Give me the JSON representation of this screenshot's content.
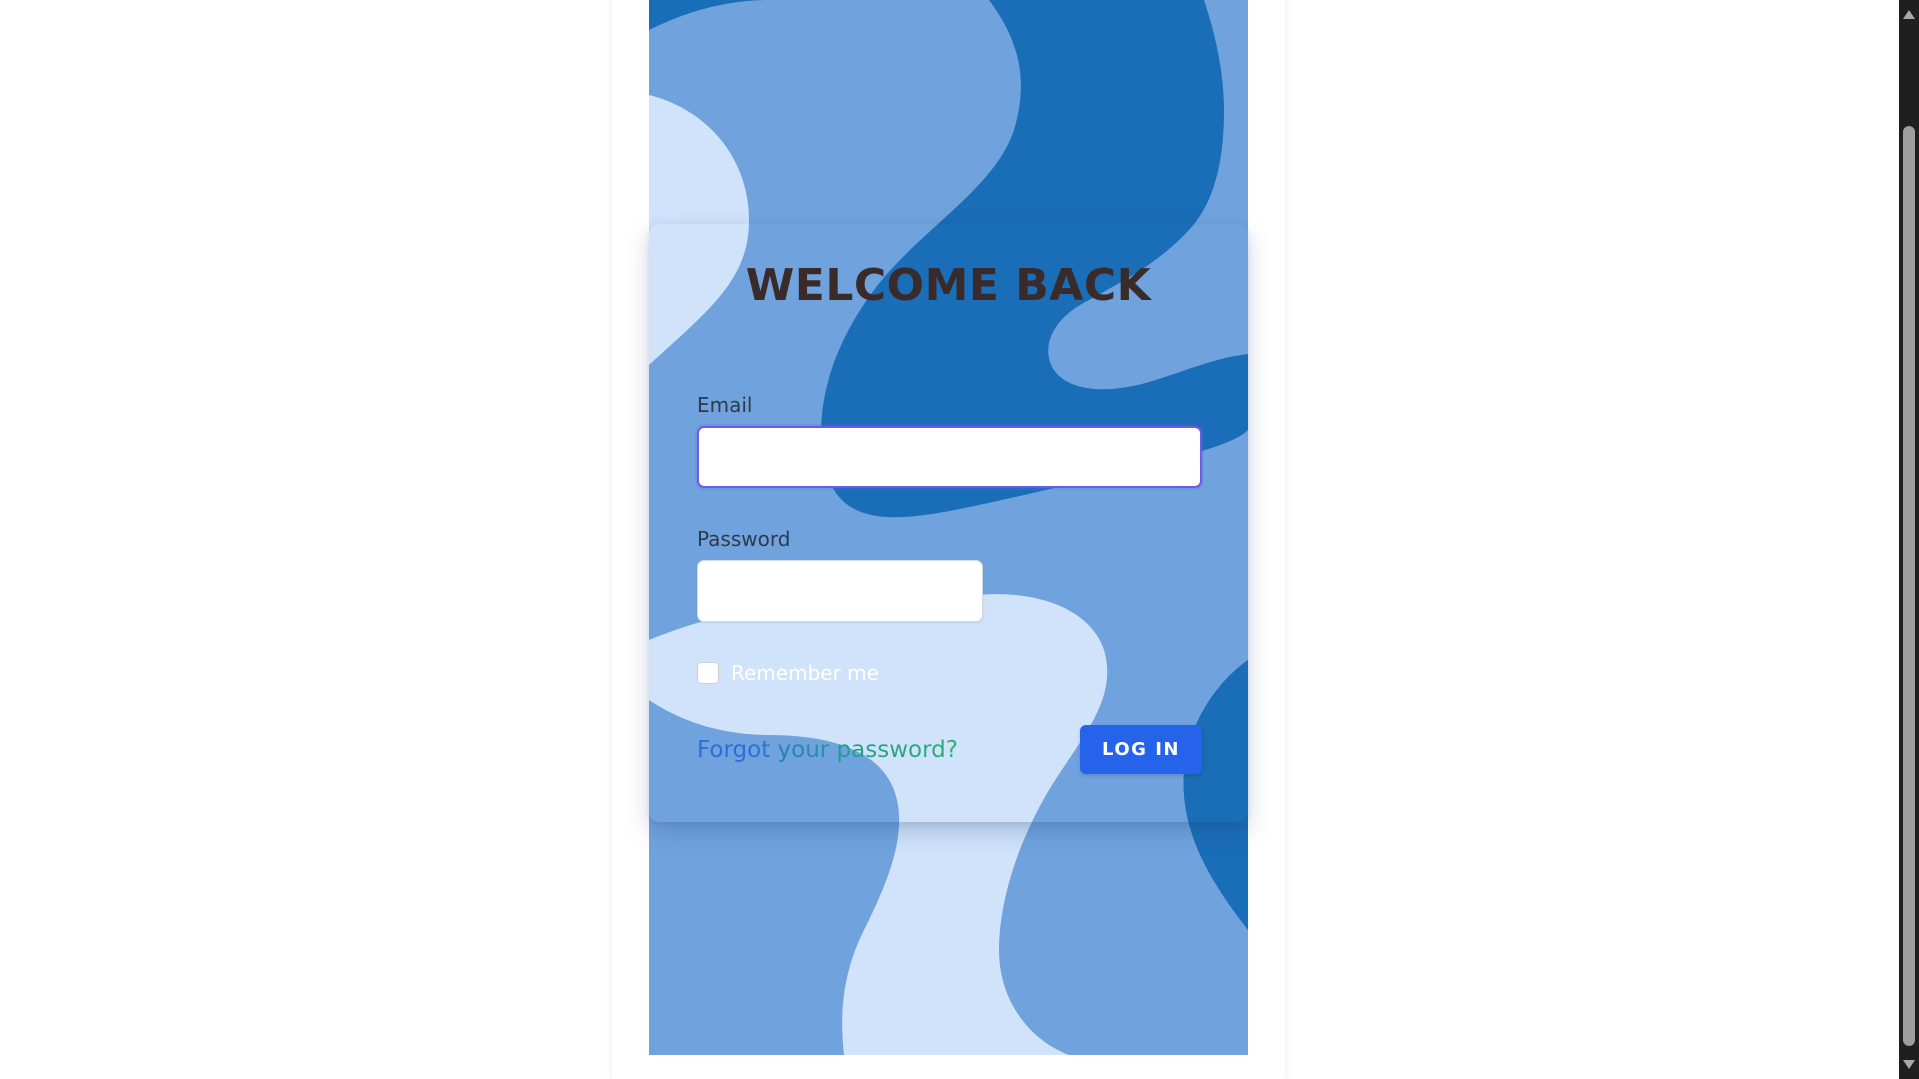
{
  "login_form": {
    "title": "WELCOME BACK",
    "email_label": "Email",
    "email_value": "",
    "password_label": "Password",
    "password_value": "",
    "remember_label": "Remember me",
    "remember_checked": false,
    "forgot_link": "Forgot your password?",
    "login_button": "LOG IN"
  },
  "colors": {
    "background_light_blue": "#70a3de",
    "background_dark_blue": "#1a6db7",
    "background_pale_blue": "#d0e3fb",
    "title_color": "#3a2b2b",
    "button_blue": "#2563eb",
    "email_focus_border": "#6b5ce7"
  },
  "scrollbar": {
    "up_icon": "triangle-up-icon",
    "down_icon": "triangle-down-icon"
  }
}
